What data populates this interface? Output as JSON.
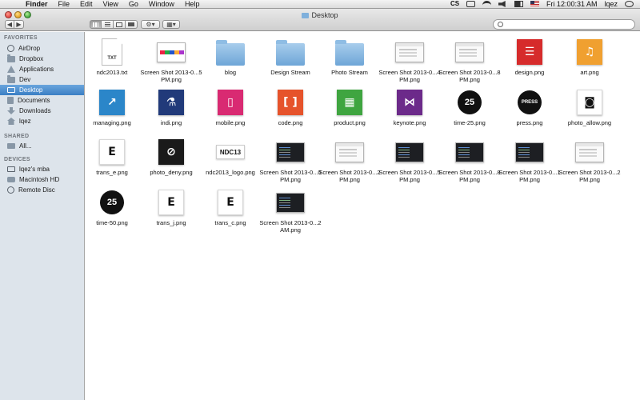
{
  "menubar": {
    "apple": "",
    "menus": [
      "Finder",
      "File",
      "Edit",
      "View",
      "Go",
      "Window",
      "Help"
    ],
    "tray_cs": "CS",
    "clock": "Fri 12:00:31 AM",
    "user": "lqez"
  },
  "window": {
    "title": "Desktop",
    "nav_back": "◀",
    "nav_forward": "▶",
    "action_glyph": "⚙▾",
    "arrange_glyph": "▦▾"
  },
  "search": {
    "placeholder": ""
  },
  "sidebar": {
    "favorites_header": "FAVORITES",
    "favorites": [
      {
        "label": "AirDrop",
        "icon": "airdrop-icon"
      },
      {
        "label": "Dropbox",
        "icon": "folder-icon"
      },
      {
        "label": "Applications",
        "icon": "applications-icon"
      },
      {
        "label": "Dev",
        "icon": "folder-icon"
      },
      {
        "label": "Desktop",
        "icon": "desktop-icon"
      },
      {
        "label": "Documents",
        "icon": "documents-icon"
      },
      {
        "label": "Downloads",
        "icon": "downloads-icon"
      },
      {
        "label": "lqez",
        "icon": "home-icon"
      }
    ],
    "shared_header": "SHARED",
    "shared": [
      {
        "label": "All...",
        "icon": "network-icon"
      }
    ],
    "devices_header": "DEVICES",
    "devices": [
      {
        "label": "lqez's mba",
        "icon": "laptop-icon"
      },
      {
        "label": "Macintosh HD",
        "icon": "hard-drive-icon"
      },
      {
        "label": "Remote Disc",
        "icon": "disc-icon"
      }
    ]
  },
  "files": [
    {
      "name": "ndc2013.txt",
      "kind": "text-document",
      "label": "TXT"
    },
    {
      "name": "Screen Shot 2013-0...5 PM.png",
      "kind": "screenshot-strip"
    },
    {
      "name": "blog",
      "kind": "folder"
    },
    {
      "name": "Design Stream",
      "kind": "folder"
    },
    {
      "name": "Photo Stream",
      "kind": "folder"
    },
    {
      "name": "Screen Shot 2013-0...4 PM.png",
      "kind": "screenshot-light"
    },
    {
      "name": "Screen Shot 2013-0...8 PM.png",
      "kind": "screenshot-light"
    },
    {
      "name": "design.png",
      "kind": "tile",
      "color": "#d62b2b",
      "glyph": "☰"
    },
    {
      "name": "art.png",
      "kind": "tile",
      "color": "#f0a030",
      "glyph": "♫"
    },
    {
      "name": "managing.png",
      "kind": "tile",
      "color": "#2b86c9",
      "glyph": "↗"
    },
    {
      "name": "indi.png",
      "kind": "tile",
      "color": "#213a7a",
      "glyph": "⚗"
    },
    {
      "name": "mobile.png",
      "kind": "tile",
      "color": "#d92a72",
      "glyph": "▯"
    },
    {
      "name": "code.png",
      "kind": "tile",
      "color": "#e6532b",
      "glyph": "[ ]"
    },
    {
      "name": "product.png",
      "kind": "tile",
      "color": "#3fa540",
      "glyph": "▦"
    },
    {
      "name": "keynote.png",
      "kind": "tile",
      "color": "#6c2a8a",
      "glyph": "⋈"
    },
    {
      "name": "time-25.png",
      "kind": "circle",
      "label": "25"
    },
    {
      "name": "press.png",
      "kind": "circle",
      "label": "PRESS"
    },
    {
      "name": "photo_allow.png",
      "kind": "tile-light",
      "glyph": "◙"
    },
    {
      "name": "trans_e.png",
      "kind": "tile-light",
      "glyph": "E"
    },
    {
      "name": "photo_deny.png",
      "kind": "tile",
      "color": "#1a1a1a",
      "glyph": "⊘"
    },
    {
      "name": "ndc2013_logo.png",
      "kind": "wide-logo",
      "label": "NDC13"
    },
    {
      "name": "Screen Shot 2013-0...0 PM.png",
      "kind": "screenshot-dark"
    },
    {
      "name": "Screen Shot 2013-0...2 PM.png",
      "kind": "screenshot-light"
    },
    {
      "name": "Screen Shot 2013-0...5 PM.png",
      "kind": "screenshot-dark"
    },
    {
      "name": "Screen Shot 2013-0...8 PM.png",
      "kind": "screenshot-dark"
    },
    {
      "name": "Screen Shot 2013-0...1 PM.png",
      "kind": "screenshot-dark"
    },
    {
      "name": "Screen Shot 2013-0...2 PM.png",
      "kind": "screenshot-light"
    },
    {
      "name": "time-50.png",
      "kind": "circle",
      "label": "25"
    },
    {
      "name": "trans_j.png",
      "kind": "tile-light",
      "glyph": "E"
    },
    {
      "name": "trans_c.png",
      "kind": "tile-light",
      "glyph": "E"
    },
    {
      "name": "Screen Shot 2013-0...2 AM.png",
      "kind": "screenshot-dark"
    }
  ]
}
